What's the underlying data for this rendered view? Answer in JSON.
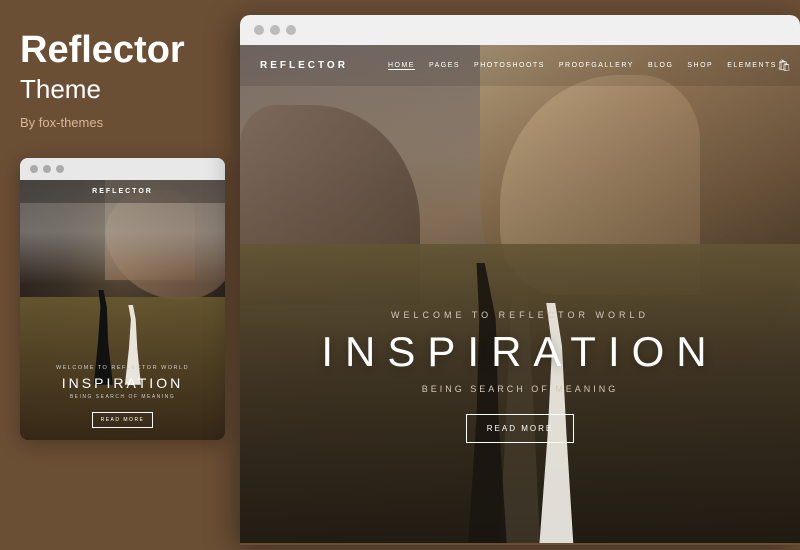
{
  "left": {
    "title": "Reflector",
    "subtitle": "Theme",
    "author": "By fox-themes"
  },
  "small_preview": {
    "logo": "REFLECTOR",
    "welcome": "WELCOME TO REFLECTOR WORLD",
    "inspiration": "INSPIRATION",
    "being": "BEING SEARCH OF MEANING",
    "read_more": "READ MORE"
  },
  "main_preview": {
    "logo": "REFLECTOR",
    "nav_links": [
      "HOME",
      "PAGES",
      "PHOTOSHOOTS",
      "PROOFGALLERY",
      "BLOG",
      "SHOP",
      "ELEMENTS"
    ],
    "welcome": "WELCOME TO REFLECTOR WORLD",
    "inspiration": "INSPIRATION",
    "being": "BEING SEARCH OF MEANING",
    "read_more": "READ MORE"
  },
  "dots": {
    "colors": [
      "#aaa",
      "#aaa",
      "#aaa"
    ]
  }
}
